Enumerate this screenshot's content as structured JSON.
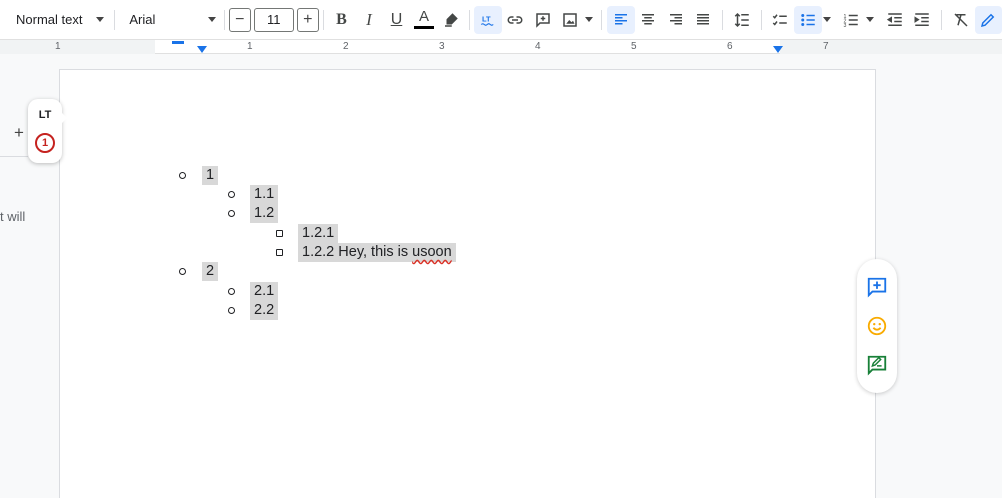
{
  "toolbar": {
    "style_label": "Normal text",
    "font_label": "Arial",
    "font_size": "11",
    "minus": "−",
    "plus": "+",
    "bold": "B",
    "italic": "I",
    "underline": "U",
    "text_color": "A"
  },
  "ruler": {
    "numbers": [
      "1",
      "1",
      "2",
      "3",
      "4",
      "5",
      "6",
      "7"
    ]
  },
  "left_edge": {
    "plus": "+",
    "text": "t will"
  },
  "lt_widget": {
    "logo": "LT",
    "count": "1"
  },
  "document": {
    "items": [
      {
        "text": "1",
        "level": 0
      },
      {
        "text": "1.1",
        "level": 1
      },
      {
        "text": "1.2",
        "level": 1
      },
      {
        "text": "1.2.1",
        "level": 2
      },
      {
        "text_before": "1.2.2 Hey, this is ",
        "misspelled": "usoon",
        "text_after": " ",
        "level": 2
      },
      {
        "text": "2",
        "level": 0
      },
      {
        "text": "2.1",
        "level": 1
      },
      {
        "text": "2.2",
        "level": 1
      }
    ]
  },
  "colors": {
    "accent": "#1a73e8",
    "error": "#d93025",
    "highlight": "#d8d8d8",
    "emoji": "#f9ab00",
    "suggest": "#188038"
  },
  "icons": {
    "right_panel": [
      "add-comment-icon",
      "emoji-reaction-icon",
      "suggest-edits-icon"
    ]
  }
}
